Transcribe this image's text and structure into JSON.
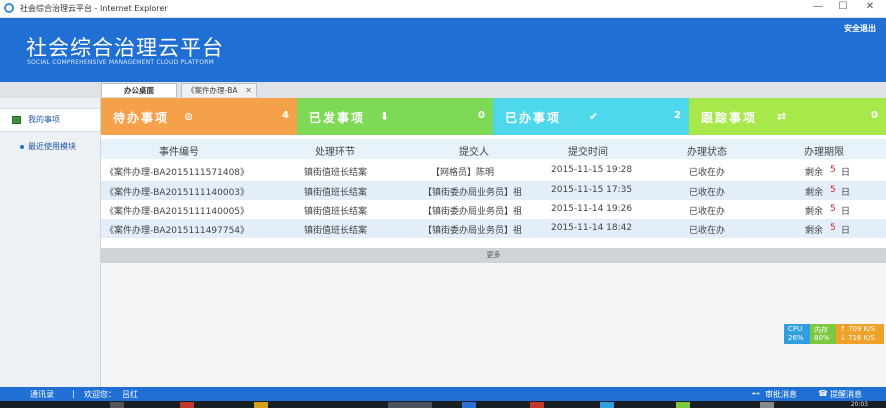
{
  "window": {
    "title": "社会综合治理云平台 - Internet Explorer",
    "controls": [
      "—",
      "☐",
      "✕"
    ]
  },
  "header": {
    "brand": "社会综合治理云平台",
    "subtitle": "SOCIAL COMPREHENSIVE MANAGEMENT CLOUD PLATFORM",
    "logout": "安全退出"
  },
  "tabs": [
    {
      "label": "办公桌面",
      "active": true
    },
    {
      "label": "《案件办理-BA",
      "close": "✕",
      "active": false
    }
  ],
  "sidebar": {
    "items": [
      {
        "label": "我的事项"
      },
      {
        "label": "最近使用模块"
      }
    ]
  },
  "cards": [
    {
      "label": "待办事项",
      "icon": "clock-icon",
      "glyph": "⊙",
      "count": "4",
      "color": "#f5a14a"
    },
    {
      "label": "已发事项",
      "icon": "download-icon",
      "glyph": "⬇",
      "count": "0",
      "color": "#7ed957"
    },
    {
      "label": "已办事项",
      "icon": "check-icon",
      "glyph": "✔",
      "count": "2",
      "color": "#4fd8ec"
    },
    {
      "label": "跟踪事项",
      "icon": "retweet-icon",
      "glyph": "⇄",
      "count": "0",
      "color": "#a7e84a"
    }
  ],
  "table": {
    "headers": [
      "事件编号",
      "处理环节",
      "提交人",
      "提交时间",
      "办理状态",
      "办理期限"
    ],
    "rows": [
      {
        "id": "《案件办理-BA2015111571408》",
        "step": "镇街值班长结案",
        "submitter": "【网格员】陈明",
        "time": "2015-11-15 19:28",
        "status": "已收在办",
        "limit_prefix": "剩余",
        "limit_num": "5",
        "limit_unit": "日"
      },
      {
        "id": "《案件办理-BA2015111140003》",
        "step": "镇街值班长结案",
        "submitter": "【镇街委办局业务员】祖",
        "time": "2015-11-15 17:35",
        "status": "已收在办",
        "limit_prefix": "剩余",
        "limit_num": "5",
        "limit_unit": "日"
      },
      {
        "id": "《案件办理-BA2015111140005》",
        "step": "镇街值班长结案",
        "submitter": "【镇街委办局业务员】祖",
        "time": "2015-11-14 19:26",
        "status": "已收在办",
        "limit_prefix": "剩余",
        "limit_num": "5",
        "limit_unit": "日"
      },
      {
        "id": "《案件办理-BA2015111497754》",
        "step": "镇街值班长结案",
        "submitter": "【镇街委办局业务员】祖",
        "time": "2015-11-14 18:42",
        "status": "已收在办",
        "limit_prefix": "剩余",
        "limit_num": "5",
        "limit_unit": "日"
      }
    ],
    "more": "更多"
  },
  "perf": {
    "cpu_label": "CPU",
    "cpu_value": "26%",
    "mem_label": "内存",
    "mem_value": "80%",
    "up": "↑ 709 K/S",
    "down": "↓ 716 K/S"
  },
  "footer": {
    "contacts": "通讯录",
    "separator": "|",
    "welcome": "欢迎您：",
    "user": "吕红",
    "approval": "审批消息",
    "reminder": "提醒消息"
  },
  "taskbar": {
    "clock": "20:03"
  },
  "colors": {
    "brand_blue": "#1f6fd4",
    "table_alt": "#e4eefa",
    "deadline_red": "#d22222"
  }
}
